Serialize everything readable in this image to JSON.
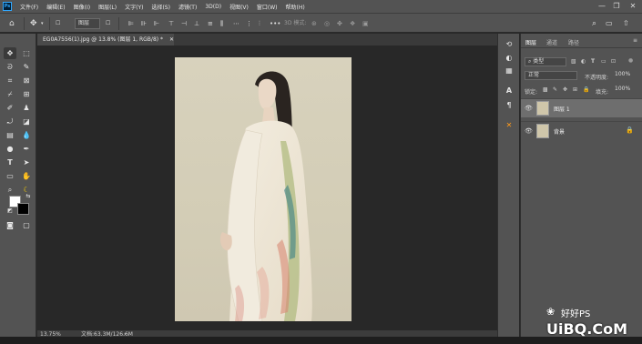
{
  "app": {
    "logo": "Ps"
  },
  "menu": [
    "文件(F)",
    "编辑(E)",
    "图像(I)",
    "图层(L)",
    "文字(Y)",
    "选择(S)",
    "滤镜(T)",
    "3D(D)",
    "视图(V)",
    "窗口(W)",
    "帮助(H)"
  ],
  "window_controls": {
    "minimize": "—",
    "restore": "❐",
    "close": "✕"
  },
  "options": {
    "layer_select": "图层",
    "mode_label": "3D 模式:"
  },
  "document": {
    "tab_title": "EG0A7556(1).jpg @ 13.8% (图层 1, RGB/8) *",
    "zoom": "13.75%",
    "file_info": "文档:63.3M/126.6M"
  },
  "panel": {
    "tabs": [
      "图层",
      "通道",
      "路径"
    ],
    "filter_kind": "类型",
    "blend_mode": "正常",
    "opacity_label": "不透明度:",
    "opacity_value": "100%",
    "lock_label": "锁定:",
    "fill_label": "填充:",
    "fill_value": "100%",
    "layers": [
      {
        "name": "图层 1",
        "selected": true
      },
      {
        "name": "背景",
        "locked": true
      }
    ]
  },
  "watermark": {
    "channel": "好好PS",
    "site": "UiBQ.CoM"
  },
  "colors": {
    "accent": "#31a8ff",
    "chrome": "#535353",
    "canvas": "#282828",
    "photo_bg": "#d6d0ba"
  }
}
